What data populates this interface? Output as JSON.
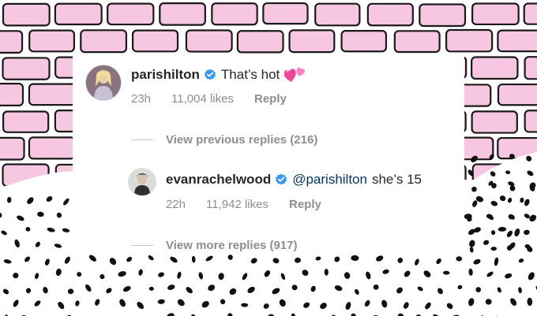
{
  "comments": [
    {
      "username": "parishilton",
      "verified": true,
      "text": "That’s hot",
      "emoji": "two-hearts-icon",
      "time": "23h",
      "likes": "11,004 likes",
      "reply_label": "Reply"
    },
    {
      "username": "evanrachelwood",
      "verified": true,
      "mention": "@parishilton",
      "text": "she’s 15",
      "time": "22h",
      "likes": "11,942 likes",
      "reply_label": "Reply"
    }
  ],
  "view_previous_replies": "View previous replies (216)",
  "view_more_replies": "View more replies (917)",
  "colors": {
    "brick": "#f7c6e0",
    "brick_mortar": "#1a1a1a",
    "dot": "#111111",
    "verified_blue": "#3897f0",
    "mention": "#00376b",
    "muted": "#8e8e8e",
    "heart": "#f0479a"
  }
}
